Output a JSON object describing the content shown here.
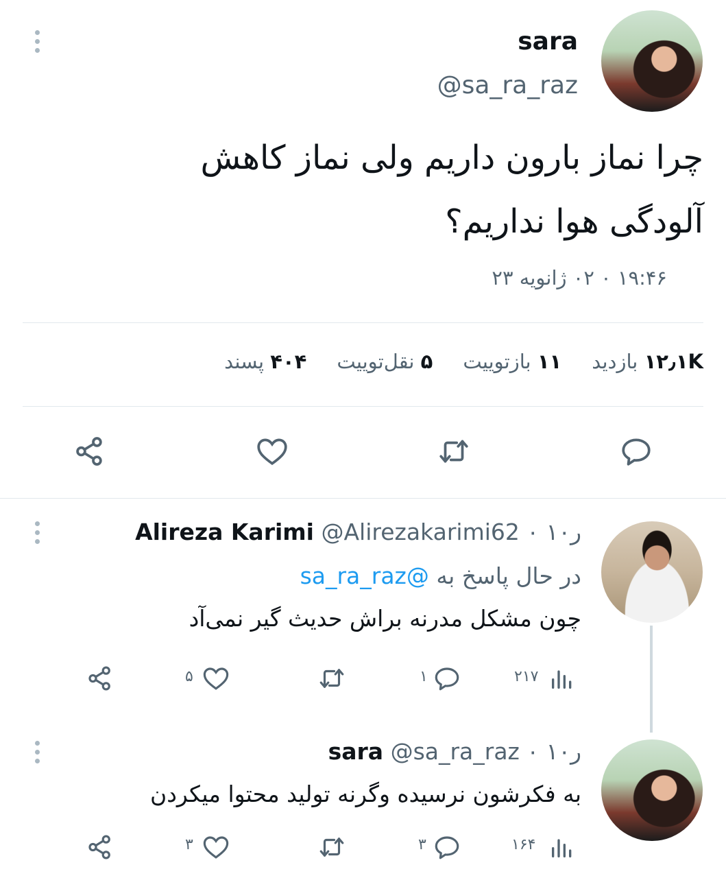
{
  "main_tweet": {
    "name": "sara",
    "handle": "@sa_ra_raz",
    "text_line1": "چرا نماز بارون داریم ولی نماز کاهش",
    "text_line2": "آلودگی هوا نداریم؟",
    "timestamp": "۱۹:۴۶ ۰ ۰۲ ژانویه ۲۳",
    "stats": {
      "views_value": "۱۲٫۱K",
      "views_label": "بازدید",
      "retweets_value": "۱۱",
      "retweets_label": "بازتوییت",
      "quotes_value": "۵",
      "quotes_label": "نقل‌توییت",
      "likes_value": "۴۰۴",
      "likes_label": "پسند"
    }
  },
  "reply1": {
    "name": "Alireza Karimi",
    "handle": "@Alirezakarimi62",
    "time": "۰ ۱۰ر",
    "replying_prefix": "در حال پاسخ به",
    "replying_handle": "@sa_ra_raz",
    "text": "چون مشکل مدرنه براش حدیث گیر نمی‌آد",
    "views": "۲۱۷",
    "replies": "۱",
    "retweets": "",
    "likes": "۵"
  },
  "reply2": {
    "name": "sara",
    "handle": "@sa_ra_raz",
    "time": "۰ ۱۰ر",
    "text": "به فکرشون نرسیده وگرنه تولید محتوا میکردن",
    "views": "۱۶۴",
    "replies": "۳",
    "retweets": "",
    "likes": "۳"
  },
  "colors": {
    "accent": "#1d9bf0",
    "muted": "#536471",
    "divider": "#e1e8ed"
  }
}
